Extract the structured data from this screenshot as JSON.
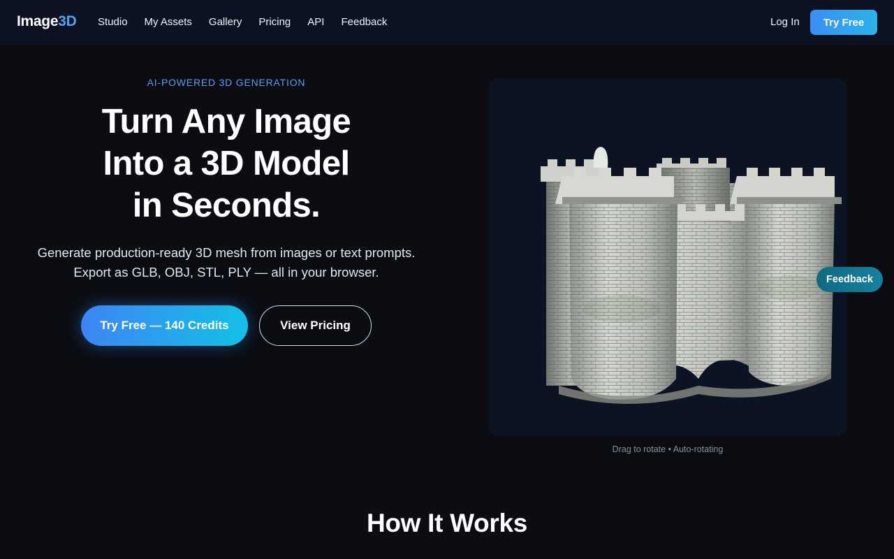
{
  "nav": {
    "logo_main": "Image",
    "logo_accent": "3D",
    "links": [
      "Studio",
      "My Assets",
      "Gallery",
      "Pricing",
      "API",
      "Feedback"
    ],
    "login": "Log In",
    "try_free": "Try Free"
  },
  "hero": {
    "eyebrow": "AI-POWERED 3D GENERATION",
    "headline": [
      "Turn Any Image",
      "Into a 3D Model",
      "in Seconds."
    ],
    "subtext": [
      "Generate production-ready 3D mesh from images or text prompts.",
      "Export as GLB, OBJ, STL, PLY — all in your browser."
    ],
    "primary_cta": "Try Free — 140 Credits",
    "secondary_cta": "View Pricing"
  },
  "viewer": {
    "caption": "Drag to rotate • Auto-rotating",
    "model_icon": "castle-model"
  },
  "feedback_tab": "Feedback",
  "how_it_works": {
    "title": "How It Works"
  }
}
